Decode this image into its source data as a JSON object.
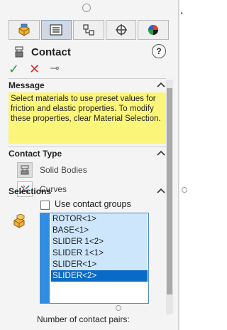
{
  "toolbar": {
    "tabs": [
      {
        "icon": "feature-manager-icon",
        "active": false
      },
      {
        "icon": "property-manager-icon",
        "active": true
      },
      {
        "icon": "configuration-manager-icon",
        "active": false
      },
      {
        "icon": "dimxpert-icon",
        "active": false
      },
      {
        "icon": "display-manager-icon",
        "active": false
      }
    ]
  },
  "header": {
    "title": "Contact",
    "help": "?"
  },
  "actions": {
    "ok": "✓",
    "cancel": "✕",
    "pin": "⊸"
  },
  "message": {
    "heading": "Message",
    "text": "Select materials to use preset values for friction and elastic properties. To modify these properties, clear Material Selection."
  },
  "contact_type": {
    "heading": "Contact Type",
    "options": [
      {
        "label": "Solid Bodies"
      },
      {
        "label": "Curves"
      }
    ]
  },
  "selections": {
    "heading": "Selections",
    "use_contact_groups_label": "Use contact groups",
    "use_contact_groups_checked": false,
    "items": [
      "ROTOR<1>",
      "BASE<1>",
      "SLIDER 1<2>",
      "SLIDER 1<1>",
      "SLIDER<1>",
      "SLIDER<2>"
    ],
    "selected_index": 5
  },
  "footer": {
    "pairs_label": "Number of contact pairs:"
  },
  "colors": {
    "message_bg": "#fbf57a",
    "list_bg": "#cde6fb",
    "list_selected": "#0a6ac7",
    "list_stripe": "#2f8de4",
    "ok": "#2a9d3b",
    "cancel": "#d0322d"
  }
}
